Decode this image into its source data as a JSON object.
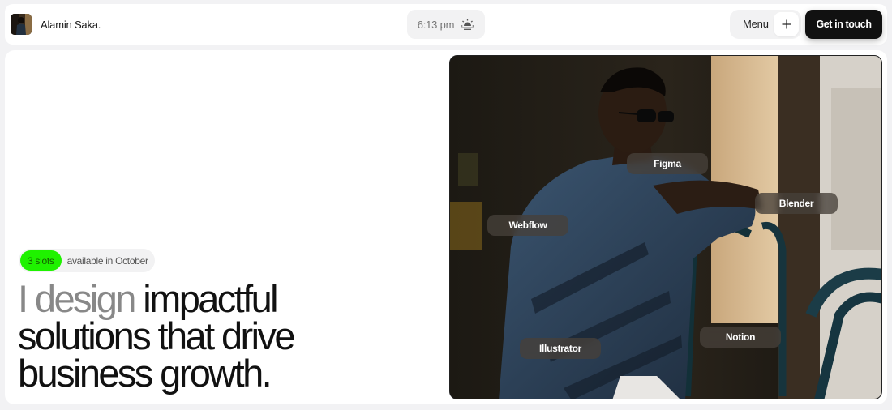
{
  "header": {
    "brand_name": "Alamin Saka.",
    "avatar_icon": "profile-photo",
    "time": "6:13 pm",
    "time_icon": "sunset-icon",
    "menu_label": "Menu",
    "menu_icon": "plus-icon",
    "cta_label": "Get in touch"
  },
  "hero": {
    "availability": {
      "slots_label": "3 slots",
      "text": "available in October",
      "badge_color": "#1ff200"
    },
    "headline_muted": "I design",
    "headline_main": "impactful solutions that drive business growth."
  },
  "photo": {
    "tags": [
      "Figma",
      "Blender",
      "Webflow",
      "Illustrator",
      "Notion"
    ]
  }
}
